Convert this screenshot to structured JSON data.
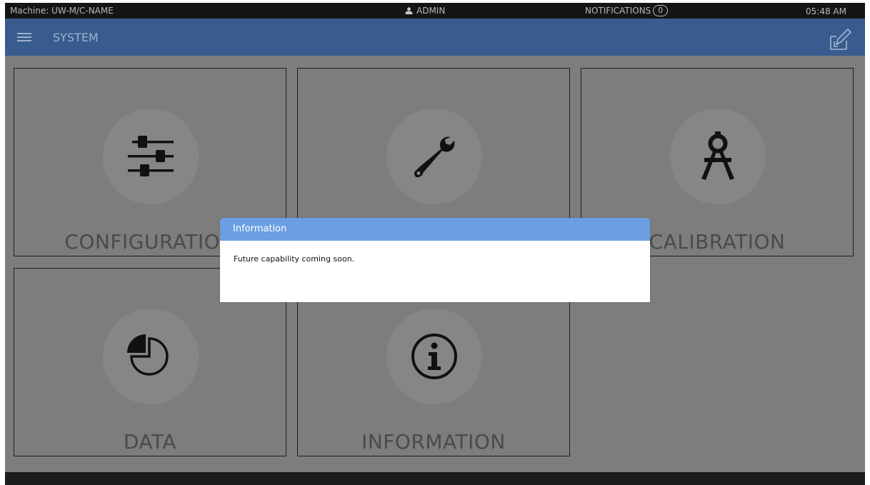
{
  "status_bar": {
    "machine": "Machine: UW-M/C-NAME",
    "user": "ADMIN",
    "notifications_label": "NOTIFICATIONS",
    "notifications_count": "0",
    "time": "05:48 AM"
  },
  "header": {
    "title": "SYSTEM",
    "menu_icon": "hamburger-menu-icon",
    "action_icon": "edit-icon"
  },
  "tiles": [
    {
      "label": "CONFIGURATION",
      "icon": "sliders-icon"
    },
    {
      "label": "",
      "icon": "wrench-icon"
    },
    {
      "label": "CALIBRATION",
      "icon": "compass-icon"
    },
    {
      "label": "DATA",
      "icon": "pie-chart-icon"
    },
    {
      "label": "INFORMATION",
      "icon": "info-icon"
    }
  ],
  "dialog": {
    "title": "Information",
    "message": "Future capability coming soon."
  },
  "colors": {
    "background": "#7d7d7d",
    "header": "#385c8e",
    "dialog_title_bar": "#6b9fe2",
    "status_bar": "#151515"
  }
}
